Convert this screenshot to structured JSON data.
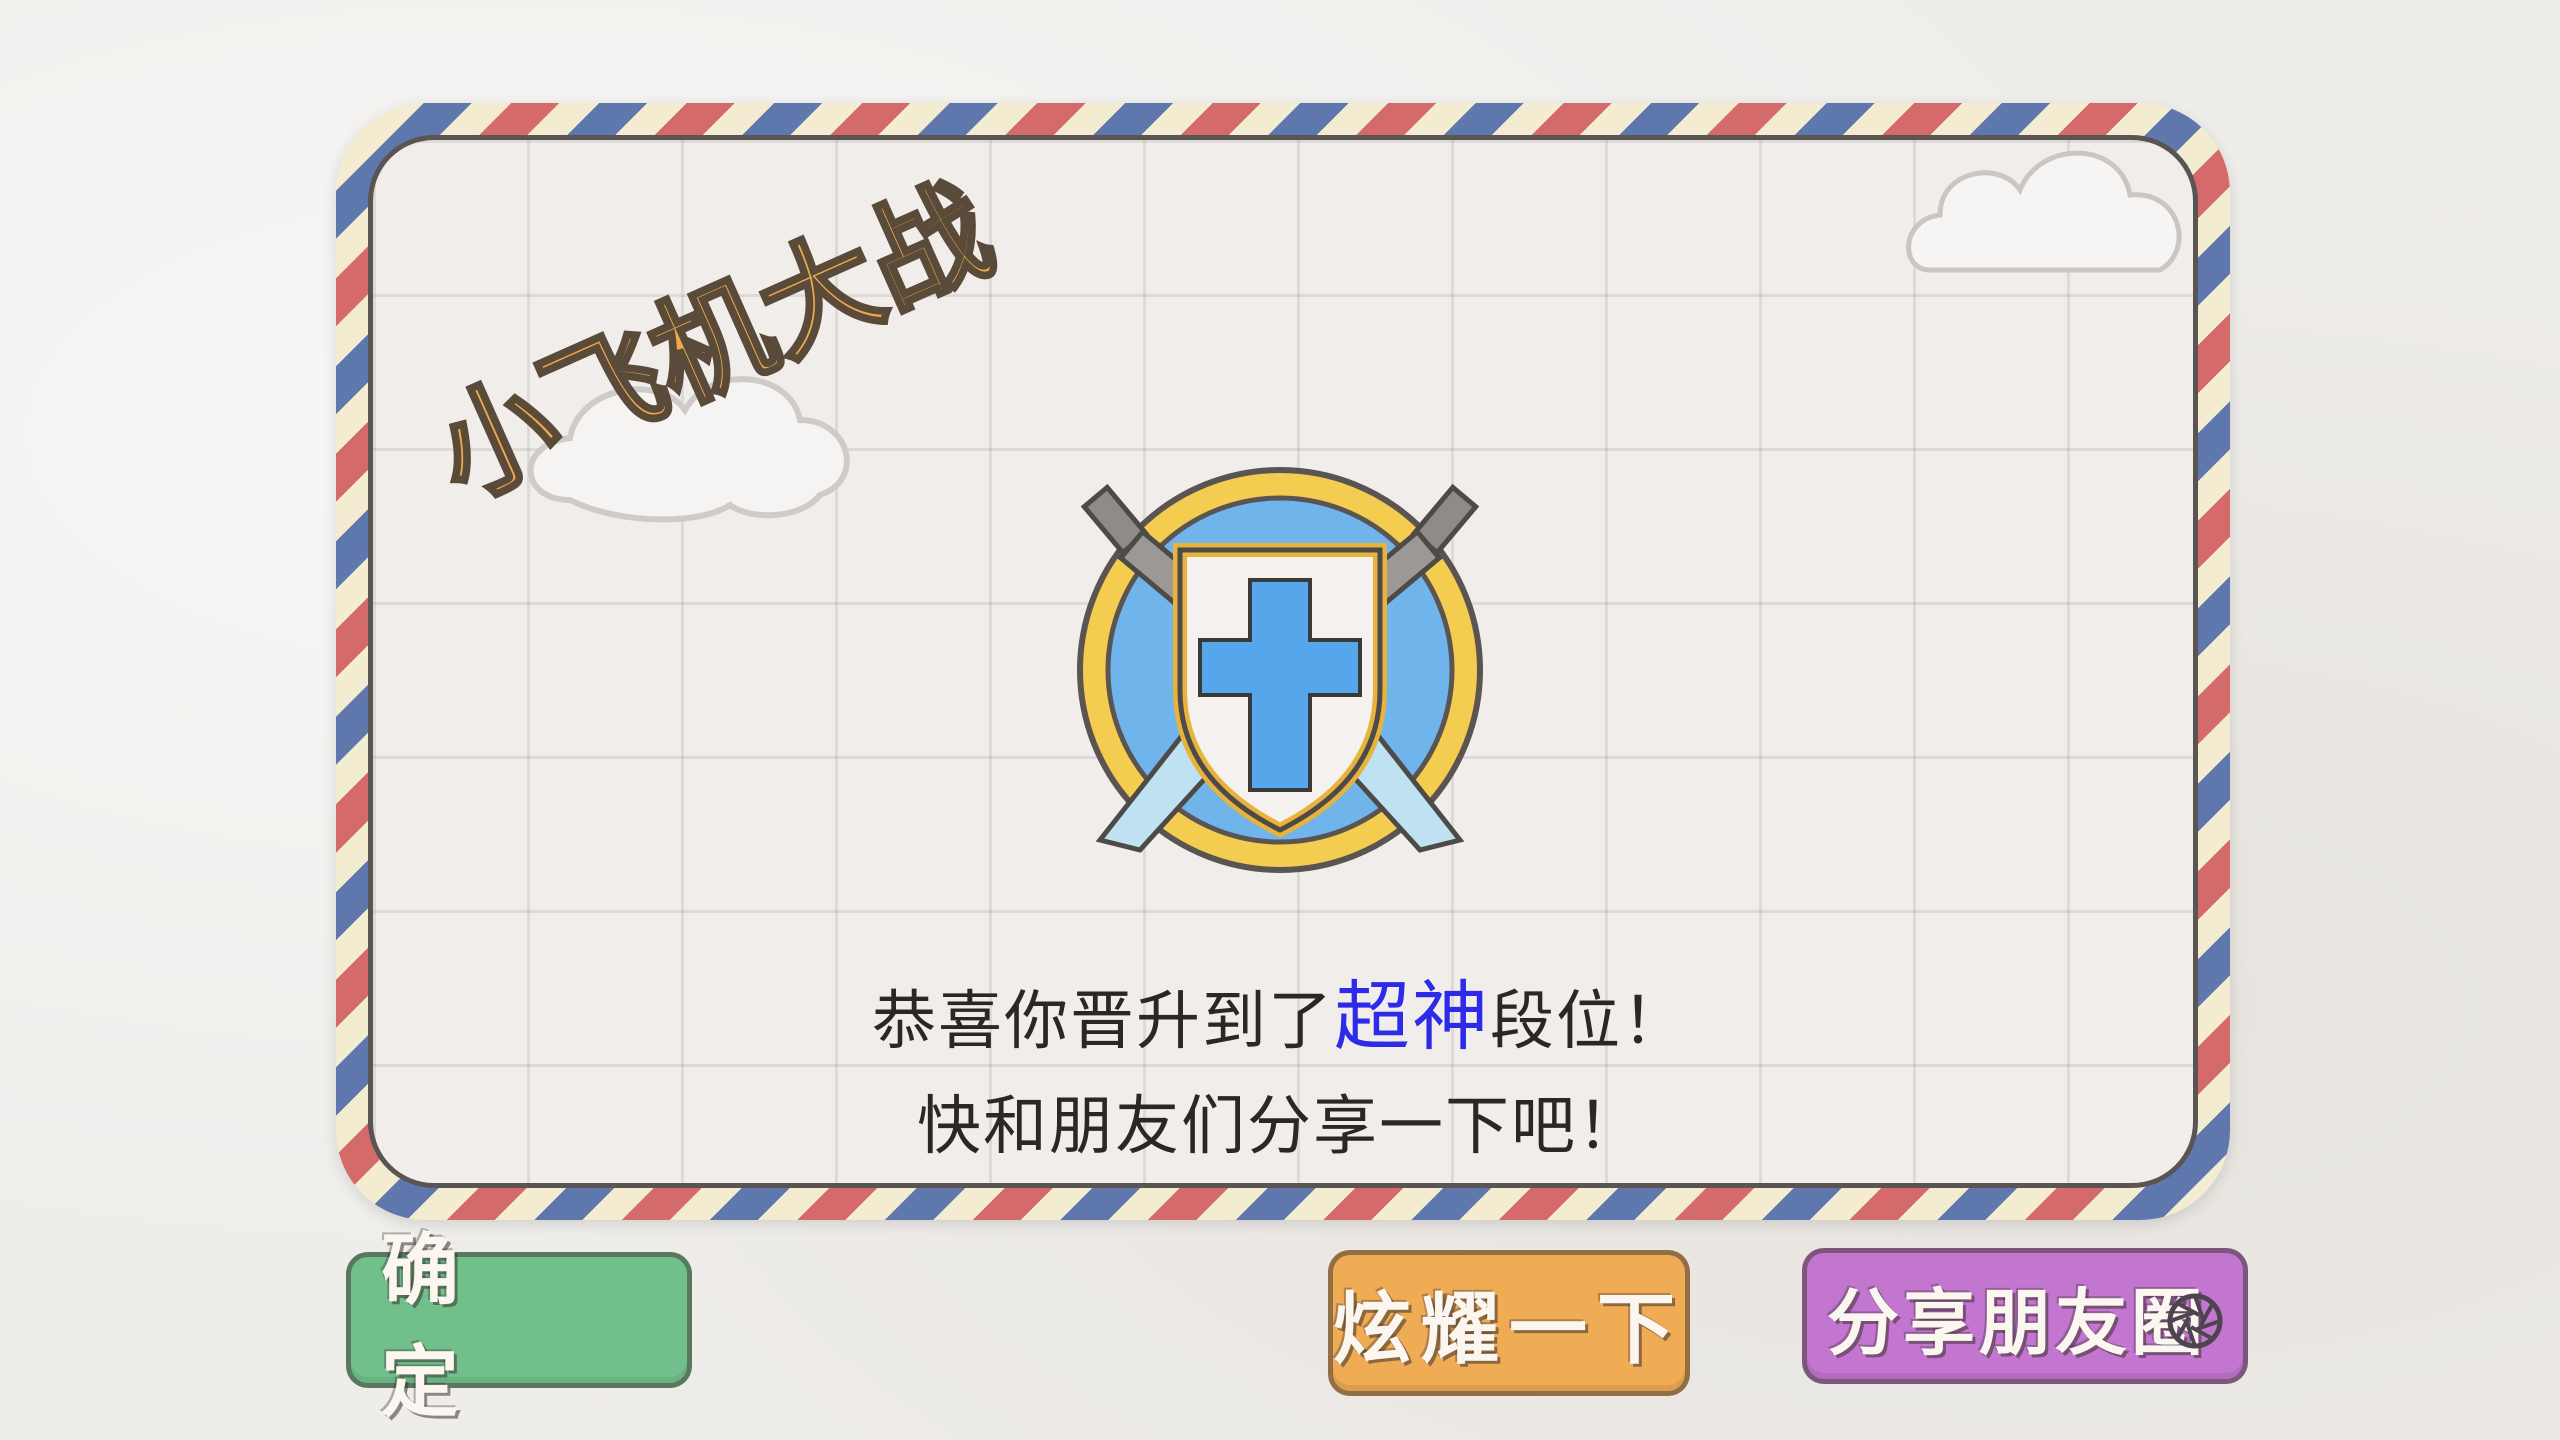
{
  "game": {
    "title_logo": "小飞机大战"
  },
  "dialog": {
    "line1_prefix": "恭喜你晋升到了",
    "rank_name": "超神",
    "line1_suffix": "段位！",
    "line2": "快和朋友们分享一下吧！"
  },
  "buttons": {
    "confirm": "确 定",
    "show_off": "炫耀一下",
    "share_moments": "分享朋友圈"
  },
  "icons": {
    "rank_emblem": "crossed-swords-shield-icon",
    "share": "camera-shutter-icon"
  },
  "colors": {
    "rank_highlight": "#2d2ae8",
    "confirm_button": "#71c08c",
    "show_button": "#f0ab55",
    "share_button": "#c276cf"
  }
}
